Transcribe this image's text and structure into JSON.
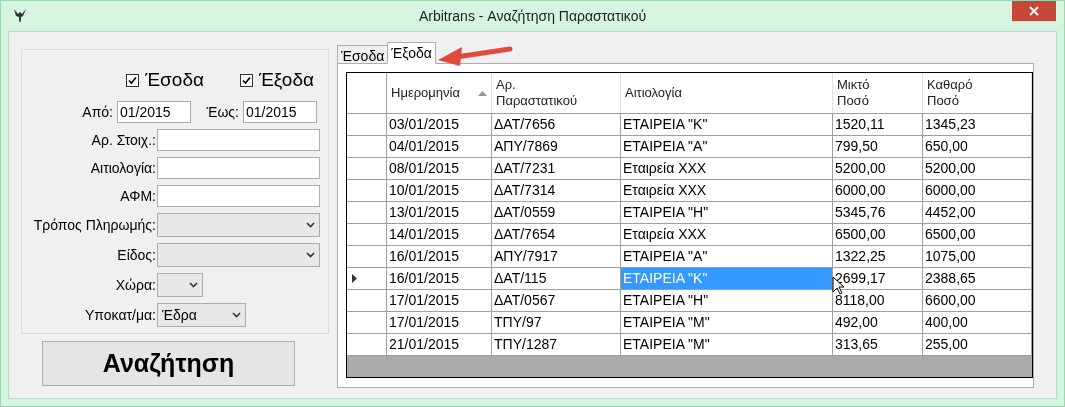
{
  "window": {
    "title": "Arbitrans - Αναζήτηση Παραστατικού"
  },
  "filters": {
    "checkboxes": [
      {
        "label": "Έσοδα",
        "checked": true
      },
      {
        "label": "Έξοδα",
        "checked": true
      }
    ],
    "from": {
      "label": "Από:",
      "value": "01/2015"
    },
    "to": {
      "label": "Έως:",
      "value": "01/2015"
    },
    "fields": [
      {
        "kind": "text",
        "label": "Αρ. Στοιχ.:"
      },
      {
        "kind": "text",
        "label": "Αιτιολογία:"
      },
      {
        "kind": "text",
        "label": "ΑΦΜ:"
      },
      {
        "kind": "select",
        "label": "Τρόπος Πληρωμής:"
      },
      {
        "kind": "select",
        "label": "Είδος:"
      },
      {
        "kind": "select",
        "label": "Χώρα:"
      },
      {
        "kind": "select",
        "label": "Υποκατ/μα:",
        "value": "Έδρα"
      }
    ]
  },
  "search_button": "Αναζήτηση",
  "tabs": [
    {
      "label": "Έσοδα",
      "selected": false
    },
    {
      "label": "Έξοδα",
      "selected": true
    }
  ],
  "table": {
    "columns": [
      {
        "label": "Ημερομηνία",
        "sorted": true
      },
      {
        "label": "Αρ. Παραστατικού",
        "sorted": false
      },
      {
        "label": "Αιτιολογία",
        "sorted": false
      },
      {
        "label": "Μικτό Ποσό",
        "sorted": false
      },
      {
        "label": "Καθαρό Ποσό",
        "sorted": false
      }
    ],
    "rows": [
      {
        "selected": false,
        "cells": [
          "03/01/2015",
          "ΔΑΤ/7656",
          "ΕΤΑΙΡΕΙΑ \"Κ\"",
          "1520,11",
          "1345,23"
        ]
      },
      {
        "selected": false,
        "cells": [
          "04/01/2015",
          "ΑΠΥ/7869",
          "ΕΤΑΙΡΕΙΑ \"Α\"",
          "799,50",
          "650,00"
        ]
      },
      {
        "selected": false,
        "cells": [
          "08/01/2015",
          "ΔΑΤ/7231",
          "Εταιρεία ΧΧΧ",
          "5200,00",
          "5200,00"
        ]
      },
      {
        "selected": false,
        "cells": [
          "10/01/2015",
          "ΔΑΤ/7314",
          "Εταιρεία ΧΧΧ",
          "6000,00",
          "6000,00"
        ]
      },
      {
        "selected": false,
        "cells": [
          "13/01/2015",
          "ΔΑΤ/0559",
          "ΕΤΑΙΡΕΙΑ \"Η\"",
          "5345,76",
          "4452,00"
        ]
      },
      {
        "selected": false,
        "cells": [
          "14/01/2015",
          "ΔΑΤ/7654",
          "Εταιρεία ΧΧΧ",
          "6500,00",
          "6500,00"
        ]
      },
      {
        "selected": false,
        "cells": [
          "16/01/2015",
          "ΑΠΥ/7917",
          "ΕΤΑΙΡΕΙΑ \"Α\"",
          "1322,25",
          "1075,00"
        ]
      },
      {
        "selected": true,
        "cells": [
          "16/01/2015",
          "ΔΑΤ/115",
          "ΕΤΑΙΡΕΙΑ \"Κ\"",
          "2699,17",
          "2388,65"
        ]
      },
      {
        "selected": false,
        "cells": [
          "17/01/2015",
          "ΔΑΤ/0567",
          "ΕΤΑΙΡΕΙΑ \"Η\"",
          "8118,00",
          "6600,00"
        ]
      },
      {
        "selected": false,
        "cells": [
          "17/01/2015",
          "ΤΠΥ/97",
          "ΕΤΑΙΡΕΙΑ \"Μ\"",
          "492,00",
          "400,00"
        ]
      },
      {
        "selected": false,
        "cells": [
          "21/01/2015",
          "ΤΠΥ/1287",
          "ΕΤΑΙΡΕΙΑ \"Μ\"",
          "313,65",
          "255,00"
        ]
      }
    ]
  }
}
